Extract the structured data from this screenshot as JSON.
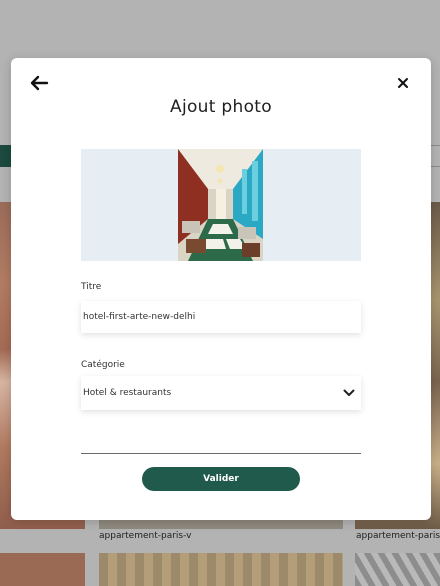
{
  "modal": {
    "title": "Ajout photo",
    "back_icon": "arrow-left-icon",
    "close_icon": "close-icon",
    "preview_image": "hotel-restaurant-photo"
  },
  "form": {
    "title_label": "Titre",
    "title_value": "hotel-first-arte-new-delhi",
    "category_label": "Catégorie",
    "category_value": "Hotel & restaurants",
    "category_icon": "chevron-down-icon",
    "submit_label": "Valider"
  },
  "background": {
    "captions": [
      "appartement-paris-v",
      "appartement-paris-"
    ]
  },
  "colors": {
    "accent": "#1f5a4c",
    "overlay": "#b3b3b3",
    "preview_bg": "#e6edf3"
  }
}
